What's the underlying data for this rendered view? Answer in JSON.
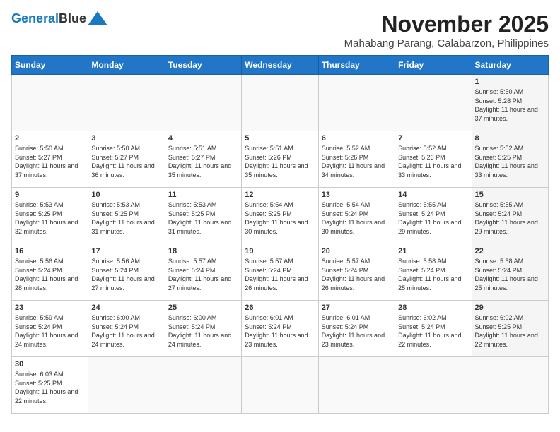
{
  "header": {
    "logo_line1": "General",
    "logo_line2": "Blue",
    "month": "November 2025",
    "location": "Mahabang Parang, Calabarzon, Philippines"
  },
  "weekdays": [
    "Sunday",
    "Monday",
    "Tuesday",
    "Wednesday",
    "Thursday",
    "Friday",
    "Saturday"
  ],
  "days": [
    {
      "date": "",
      "info": ""
    },
    {
      "date": "",
      "info": ""
    },
    {
      "date": "",
      "info": ""
    },
    {
      "date": "",
      "info": ""
    },
    {
      "date": "",
      "info": ""
    },
    {
      "date": "",
      "info": ""
    },
    {
      "date": "1",
      "info": "Sunrise: 5:50 AM\nSunset: 5:28 PM\nDaylight: 11 hours and 37 minutes."
    },
    {
      "date": "2",
      "info": "Sunrise: 5:50 AM\nSunset: 5:27 PM\nDaylight: 11 hours and 37 minutes."
    },
    {
      "date": "3",
      "info": "Sunrise: 5:50 AM\nSunset: 5:27 PM\nDaylight: 11 hours and 36 minutes."
    },
    {
      "date": "4",
      "info": "Sunrise: 5:51 AM\nSunset: 5:27 PM\nDaylight: 11 hours and 35 minutes."
    },
    {
      "date": "5",
      "info": "Sunrise: 5:51 AM\nSunset: 5:26 PM\nDaylight: 11 hours and 35 minutes."
    },
    {
      "date": "6",
      "info": "Sunrise: 5:52 AM\nSunset: 5:26 PM\nDaylight: 11 hours and 34 minutes."
    },
    {
      "date": "7",
      "info": "Sunrise: 5:52 AM\nSunset: 5:26 PM\nDaylight: 11 hours and 33 minutes."
    },
    {
      "date": "8",
      "info": "Sunrise: 5:52 AM\nSunset: 5:25 PM\nDaylight: 11 hours and 33 minutes."
    },
    {
      "date": "9",
      "info": "Sunrise: 5:53 AM\nSunset: 5:25 PM\nDaylight: 11 hours and 32 minutes."
    },
    {
      "date": "10",
      "info": "Sunrise: 5:53 AM\nSunset: 5:25 PM\nDaylight: 11 hours and 31 minutes."
    },
    {
      "date": "11",
      "info": "Sunrise: 5:53 AM\nSunset: 5:25 PM\nDaylight: 11 hours and 31 minutes."
    },
    {
      "date": "12",
      "info": "Sunrise: 5:54 AM\nSunset: 5:25 PM\nDaylight: 11 hours and 30 minutes."
    },
    {
      "date": "13",
      "info": "Sunrise: 5:54 AM\nSunset: 5:24 PM\nDaylight: 11 hours and 30 minutes."
    },
    {
      "date": "14",
      "info": "Sunrise: 5:55 AM\nSunset: 5:24 PM\nDaylight: 11 hours and 29 minutes."
    },
    {
      "date": "15",
      "info": "Sunrise: 5:55 AM\nSunset: 5:24 PM\nDaylight: 11 hours and 29 minutes."
    },
    {
      "date": "16",
      "info": "Sunrise: 5:56 AM\nSunset: 5:24 PM\nDaylight: 11 hours and 28 minutes."
    },
    {
      "date": "17",
      "info": "Sunrise: 5:56 AM\nSunset: 5:24 PM\nDaylight: 11 hours and 27 minutes."
    },
    {
      "date": "18",
      "info": "Sunrise: 5:57 AM\nSunset: 5:24 PM\nDaylight: 11 hours and 27 minutes."
    },
    {
      "date": "19",
      "info": "Sunrise: 5:57 AM\nSunset: 5:24 PM\nDaylight: 11 hours and 26 minutes."
    },
    {
      "date": "20",
      "info": "Sunrise: 5:57 AM\nSunset: 5:24 PM\nDaylight: 11 hours and 26 minutes."
    },
    {
      "date": "21",
      "info": "Sunrise: 5:58 AM\nSunset: 5:24 PM\nDaylight: 11 hours and 25 minutes."
    },
    {
      "date": "22",
      "info": "Sunrise: 5:58 AM\nSunset: 5:24 PM\nDaylight: 11 hours and 25 minutes."
    },
    {
      "date": "23",
      "info": "Sunrise: 5:59 AM\nSunset: 5:24 PM\nDaylight: 11 hours and 24 minutes."
    },
    {
      "date": "24",
      "info": "Sunrise: 6:00 AM\nSunset: 5:24 PM\nDaylight: 11 hours and 24 minutes."
    },
    {
      "date": "25",
      "info": "Sunrise: 6:00 AM\nSunset: 5:24 PM\nDaylight: 11 hours and 24 minutes."
    },
    {
      "date": "26",
      "info": "Sunrise: 6:01 AM\nSunset: 5:24 PM\nDaylight: 11 hours and 23 minutes."
    },
    {
      "date": "27",
      "info": "Sunrise: 6:01 AM\nSunset: 5:24 PM\nDaylight: 11 hours and 23 minutes."
    },
    {
      "date": "28",
      "info": "Sunrise: 6:02 AM\nSunset: 5:24 PM\nDaylight: 11 hours and 22 minutes."
    },
    {
      "date": "29",
      "info": "Sunrise: 6:02 AM\nSunset: 5:25 PM\nDaylight: 11 hours and 22 minutes."
    },
    {
      "date": "30",
      "info": "Sunrise: 6:03 AM\nSunset: 5:25 PM\nDaylight: 11 hours and 22 minutes."
    },
    {
      "date": "",
      "info": ""
    },
    {
      "date": "",
      "info": ""
    },
    {
      "date": "",
      "info": ""
    },
    {
      "date": "",
      "info": ""
    },
    {
      "date": "",
      "info": ""
    },
    {
      "date": "",
      "info": ""
    }
  ]
}
